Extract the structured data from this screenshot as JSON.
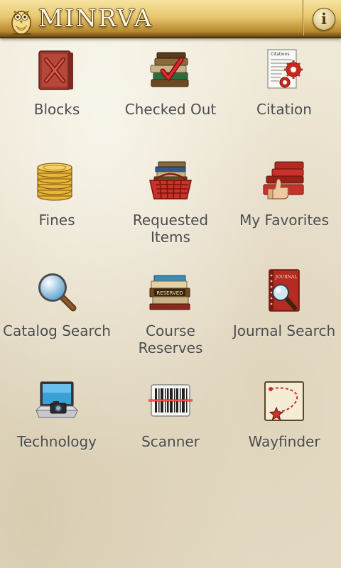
{
  "header": {
    "title": "MINRVA",
    "info_label": "i"
  },
  "tiles": [
    {
      "label": "Blocks",
      "icon": "blocked-book-icon"
    },
    {
      "label": "Checked Out",
      "icon": "checked-out-books-icon"
    },
    {
      "label": "Citation",
      "icon": "citation-gears-icon"
    },
    {
      "label": "Fines",
      "icon": "coin-stack-icon"
    },
    {
      "label": "Requested\nItems",
      "icon": "book-basket-icon"
    },
    {
      "label": "My Favorites",
      "icon": "thumbs-up-book-icon"
    },
    {
      "label": "Catalog Search",
      "icon": "magnifier-icon"
    },
    {
      "label": "Course\nReserves",
      "icon": "reserved-books-icon"
    },
    {
      "label": "Journal Search",
      "icon": "journal-magnifier-icon"
    },
    {
      "label": "Technology",
      "icon": "laptop-camera-icon"
    },
    {
      "label": "Scanner",
      "icon": "barcode-scanner-icon"
    },
    {
      "label": "Wayfinder",
      "icon": "map-star-icon"
    }
  ],
  "icon_texts": {
    "citation_label": "Citations",
    "reserved_label": "RESERVED",
    "journal_label": "JOURNAL"
  },
  "colors": {
    "header_gold": "#e8c870",
    "label_text": "#4b4b4b",
    "parchment": "#efe8d8"
  }
}
